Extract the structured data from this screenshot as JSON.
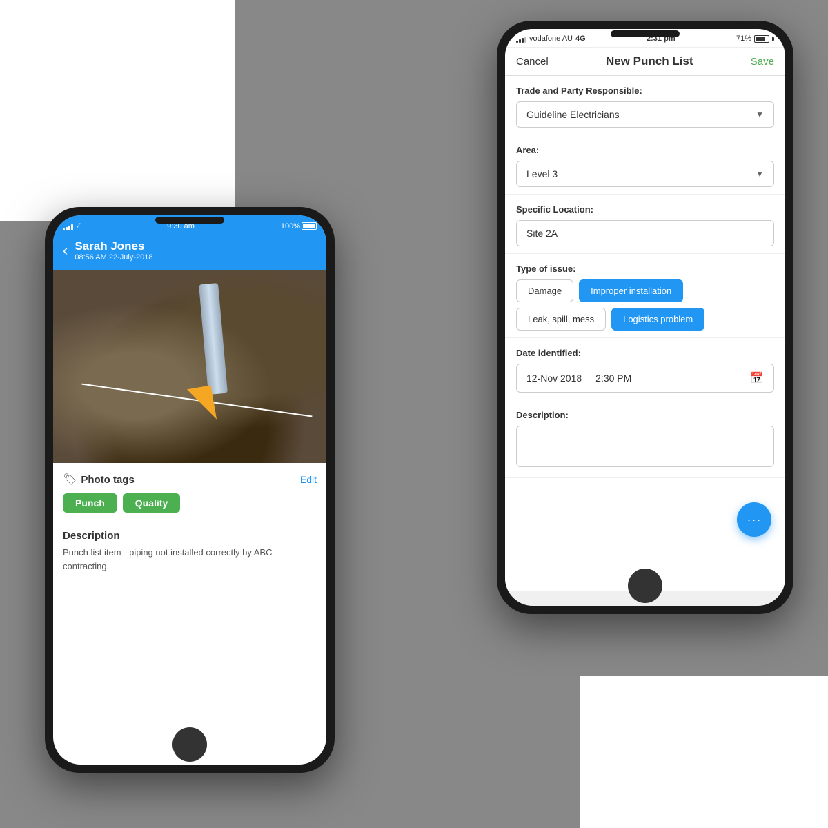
{
  "background_color": "#888888",
  "left_phone": {
    "status_bar": {
      "signal": "●●●",
      "wifi": "wifi",
      "time": "9:30 am",
      "battery": "100%"
    },
    "header": {
      "back_label": "‹",
      "user_name": "Sarah Jones",
      "date_time": "08:56 AM 22-July-2018"
    },
    "photo_tags": {
      "section_title": "Photo tags",
      "edit_label": "Edit",
      "tags": [
        "Punch",
        "Quality"
      ]
    },
    "description": {
      "title": "Description",
      "text": "Punch list item - piping not installed correctly by ABC contracting."
    }
  },
  "right_phone": {
    "status_bar": {
      "carrier": "vodafone AU",
      "network": "4G",
      "time": "2:31 pm",
      "battery": "71%"
    },
    "nav_bar": {
      "cancel_label": "Cancel",
      "title": "New Punch List",
      "save_label": "Save"
    },
    "form": {
      "trade_label": "Trade and Party Responsible:",
      "trade_value": "Guideline Electricians",
      "area_label": "Area:",
      "area_value": "Level 3",
      "location_label": "Specific Location:",
      "location_value": "Site 2A",
      "issue_label": "Type of issue:",
      "issue_options": [
        {
          "label": "Damage",
          "active": false
        },
        {
          "label": "Improper installation",
          "active": true
        },
        {
          "label": "Leak, spill, mess",
          "active": false
        },
        {
          "label": "Logistics problem",
          "active": true
        }
      ],
      "date_label": "Date identified:",
      "date_value": "12-Nov 2018",
      "time_value": "2:30 PM",
      "description_label": "Description:",
      "description_placeholder": ""
    },
    "fab": {
      "icon": "···"
    }
  }
}
